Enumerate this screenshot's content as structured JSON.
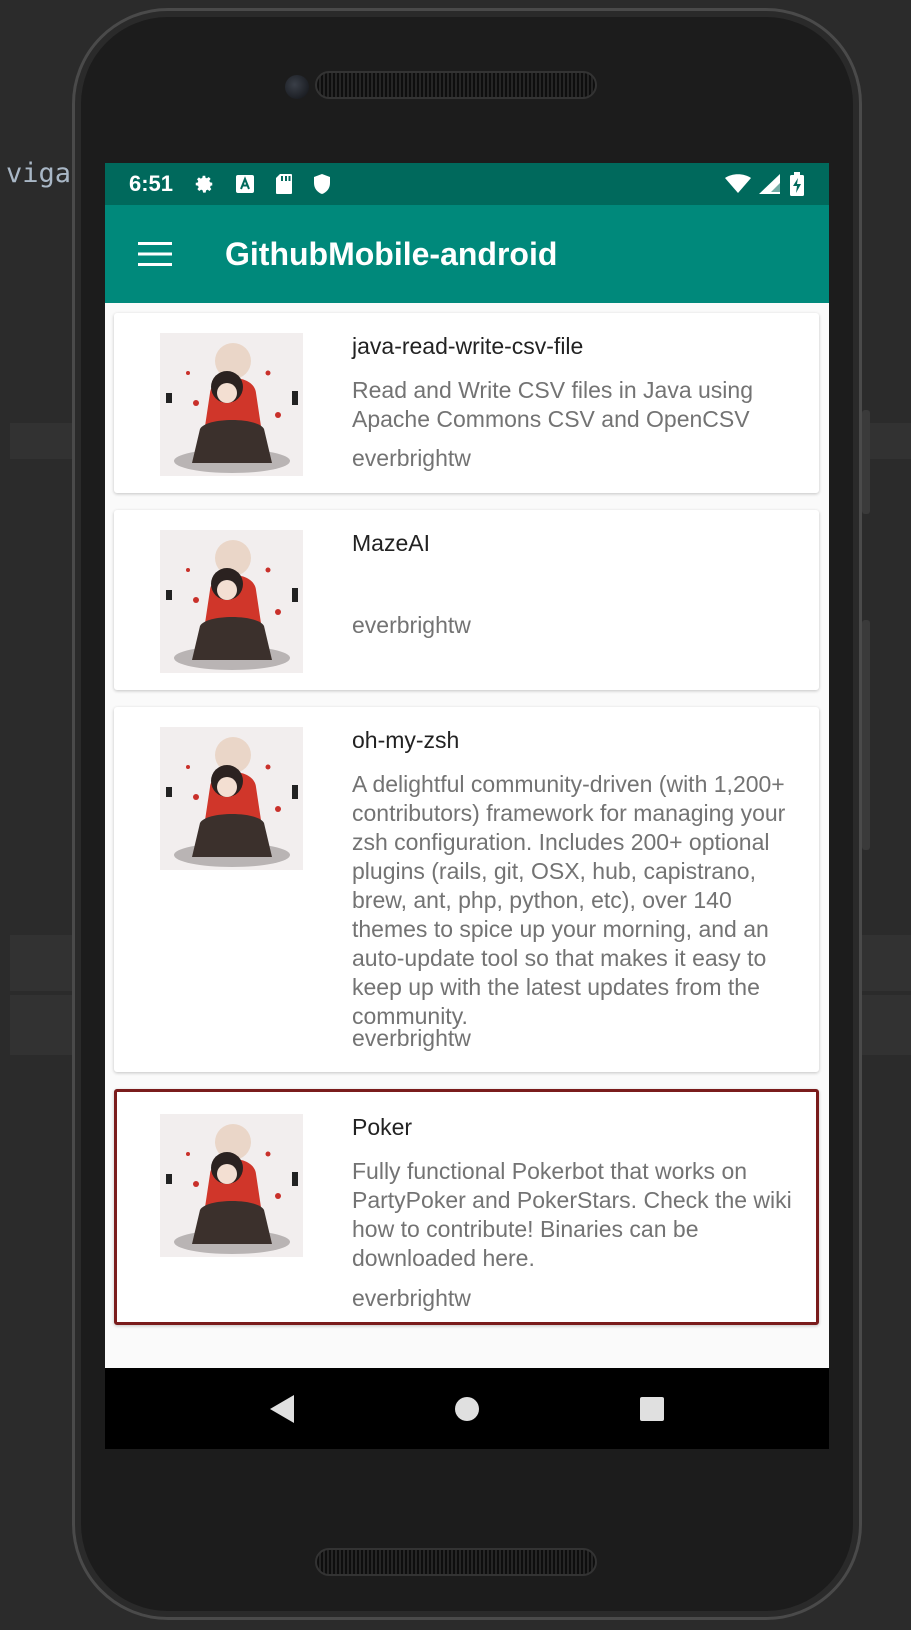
{
  "ide": {
    "snippet": "viga"
  },
  "status_bar": {
    "time": "6:51",
    "left_icons": [
      "gear-icon",
      "a-badge-icon",
      "sd-card-icon",
      "shield-icon"
    ],
    "right_icons": [
      "wifi-icon",
      "cell-signal-icon",
      "battery-charging-icon"
    ]
  },
  "app_bar": {
    "title": "GithubMobile-android",
    "menu_icon": "hamburger-menu-icon"
  },
  "repos": [
    {
      "name": "java-read-write-csv-file",
      "description": "Read and Write CSV files in Java using Apache Commons CSV and OpenCSV",
      "owner": "everbrightw"
    },
    {
      "name": "MazeAI",
      "description": "",
      "owner": "everbrightw"
    },
    {
      "name": "oh-my-zsh",
      "description": "A delightful community-driven (with 1,200+ contributors) framework for managing your zsh configuration. Includes 200+ optional plugins (rails, git, OSX, hub, capistrano, brew, ant, php, python, etc), over 140 themes to spice up your morning, and an auto-update tool so that makes it easy to keep up with the latest updates from the community.",
      "owner": "everbrightw"
    },
    {
      "name": "Poker",
      "description": "Fully functional Pokerbot that works on PartyPoker and PokerStars. Check the wiki how to contribute! Binaries can be downloaded here.",
      "owner": "everbrightw"
    }
  ],
  "nav_bar": {
    "icons": [
      "back-icon",
      "home-icon",
      "recents-icon"
    ]
  },
  "colors": {
    "status_bar": "#00695c",
    "app_bar": "#00897b",
    "focus_border": "#7a1c1c"
  }
}
